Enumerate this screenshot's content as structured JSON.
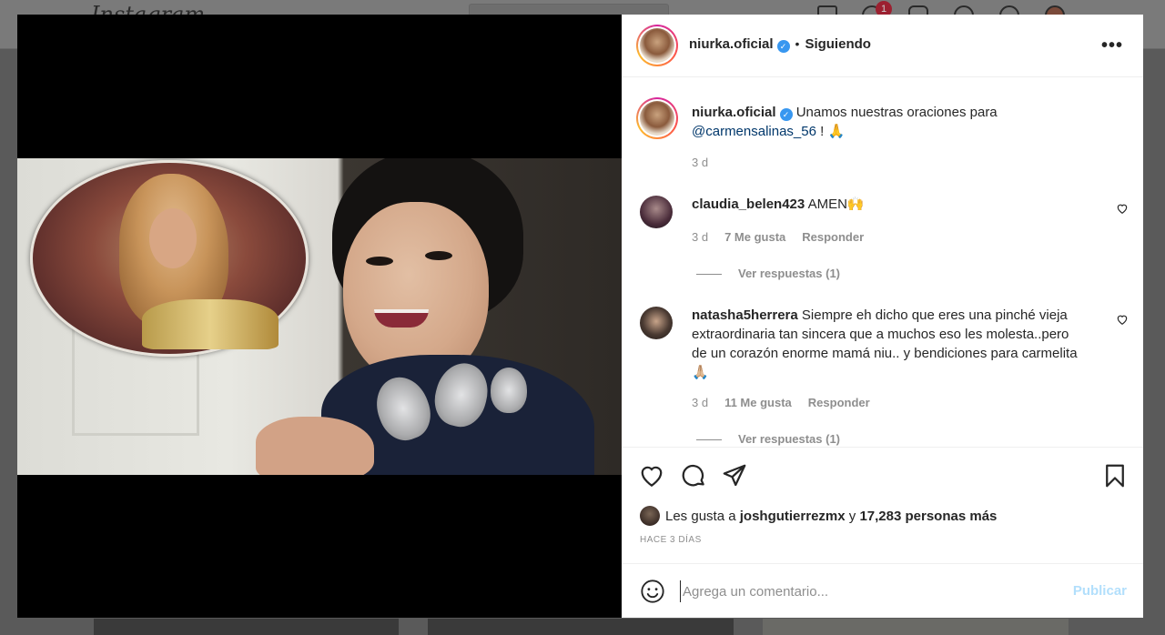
{
  "background": {
    "logo": "Instagram",
    "notification_count": "1"
  },
  "post": {
    "author": "niurka.oficial",
    "follow_status": "Siguiendo",
    "separator": "•",
    "more_icon": "more-horizontal-icon",
    "caption": {
      "username": "niurka.oficial",
      "text": "Unamos nuestras oraciones para",
      "mention": "@carmensalinas_56",
      "suffix": " ! 🙏",
      "time": "3 d"
    },
    "comments": [
      {
        "username": "claudia_belen423",
        "text": "AMEN🙌",
        "time": "3 d",
        "likes": "7 Me gusta",
        "reply": "Responder",
        "view_replies": "Ver respuestas (1)"
      },
      {
        "username": "natasha5herrera",
        "text": "Siempre eh dicho que eres una pinché vieja extraordinaria tan sincera que a muchos eso les molesta..pero de un corazón enorme mamá niu.. y bendiciones para carmelita🙏🏼",
        "time": "3 d",
        "likes": "11 Me gusta",
        "reply": "Responder",
        "view_replies": "Ver respuestas (1)"
      }
    ],
    "likes": {
      "prefix": "Les gusta a",
      "user": "joshgutierrezmx",
      "connector": "y",
      "others": "17,283 personas más"
    },
    "posted_ago": "HACE 3 DÍAS",
    "comment_placeholder": "Agrega un comentario...",
    "publish_label": "Publicar"
  },
  "colors": {
    "verified": "#3897f0",
    "link": "#00376b",
    "muted": "#8e8e8e",
    "publish_disabled": "#b2dffc"
  }
}
